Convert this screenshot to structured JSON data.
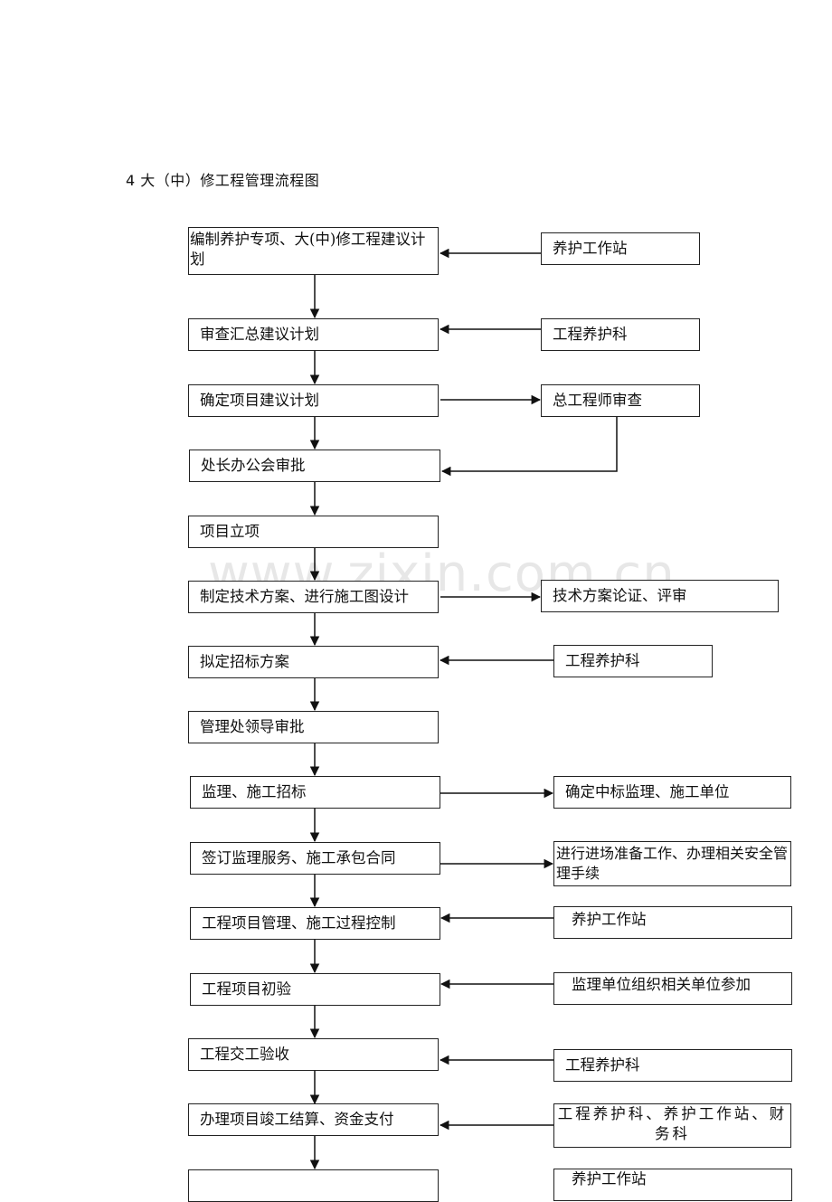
{
  "title": "4 大（中）修工程管理流程图",
  "watermark": "www.zixin.com.cn",
  "main_steps": [
    "编制养护专项、大(中)修工程建议计划",
    "审查汇总建议计划",
    "确定项目建议计划",
    "处长办公会审批",
    "项目立项",
    "制定技术方案、进行施工图设计",
    "拟定招标方案",
    "管理处领导审批",
    "监理、施工招标",
    "签订监理服务、施工承包合同",
    "工程项目管理、施工过程控制",
    "工程项目初验",
    "工程交工验收",
    "办理项目竣工结算、资金支付",
    ""
  ],
  "side_boxes": [
    {
      "text": "养护工作站",
      "step": 0,
      "direction": "into-main"
    },
    {
      "text": "工程养护科",
      "step": 1,
      "direction": "into-main"
    },
    {
      "text": "总工程师审查",
      "step": 2,
      "direction": "out-of-main",
      "returns_to_step": 3
    },
    {
      "text": "技术方案论证、评审",
      "step": 5,
      "direction": "out-of-main"
    },
    {
      "text": "工程养护科",
      "step": 6,
      "direction": "into-main"
    },
    {
      "text": "确定中标监理、施工单位",
      "step": 8,
      "direction": "out-of-main"
    },
    {
      "text": "进行进场准备工作、办理相关安全管理手续",
      "step": 9,
      "direction": "out-of-main"
    },
    {
      "text": "养护工作站",
      "step": 10,
      "direction": "into-main"
    },
    {
      "text": "监理单位组织相关单位参加",
      "step": 11,
      "direction": "into-main"
    },
    {
      "text": "工程养护科",
      "step": 12,
      "direction": "into-main"
    },
    {
      "text": "工程养护科、养护工作站、财务科",
      "step": 13,
      "direction": "into-main"
    },
    {
      "text": "养护工作站",
      "step": 14,
      "direction": "into-main"
    }
  ]
}
